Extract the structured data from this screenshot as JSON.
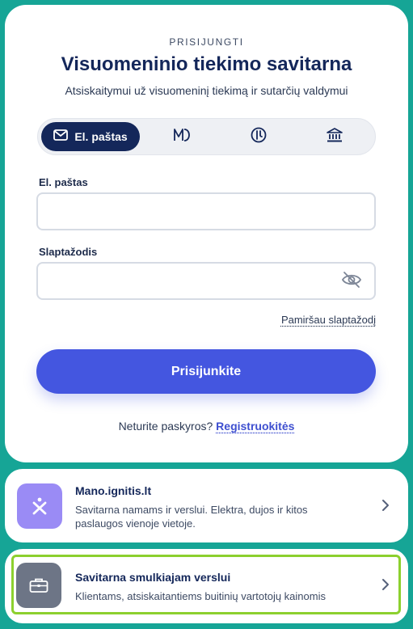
{
  "login": {
    "eyebrow": "PRISIJUNGTI",
    "title": "Visuomeninio tiekimo savitarna",
    "subtitle": "Atsiskaitymui už visuomeninį tiekimą ir sutarčių valdymui",
    "methods": [
      {
        "label": "El. paštas",
        "icon": "envelope-icon",
        "active": true
      },
      {
        "label": "",
        "icon": "m-signature-icon",
        "active": false
      },
      {
        "label": "",
        "icon": "smart-id-icon",
        "active": false
      },
      {
        "label": "",
        "icon": "bank-icon",
        "active": false
      }
    ],
    "email_label": "El. paštas",
    "email_value": "",
    "password_label": "Slaptažodis",
    "password_value": "",
    "forgot_label": "Pamiršau slaptažodį",
    "submit_label": "Prisijunkite",
    "register_prompt": "Neturite paskyros?",
    "register_label": "Registruokitės"
  },
  "cards": [
    {
      "title": "Mano.ignitis.lt",
      "description": "Savitarna namams ir verslui. Elektra, dujos ir kitos paslaugos vienoje vietoje.",
      "icon": "ignitis-logo-icon",
      "icon_color": "#9a8bf5"
    },
    {
      "title": "Savitarna smulkiajam verslui",
      "description": "Klientams, atsiskaitantiems buitinių vartotojų kainomis",
      "icon": "briefcase-icon",
      "icon_color": "#6d7586",
      "highlighted": true
    }
  ],
  "colors": {
    "background": "#16a596",
    "primary": "#4456e0",
    "navy": "#14275a",
    "highlight": "#8cd02e"
  }
}
